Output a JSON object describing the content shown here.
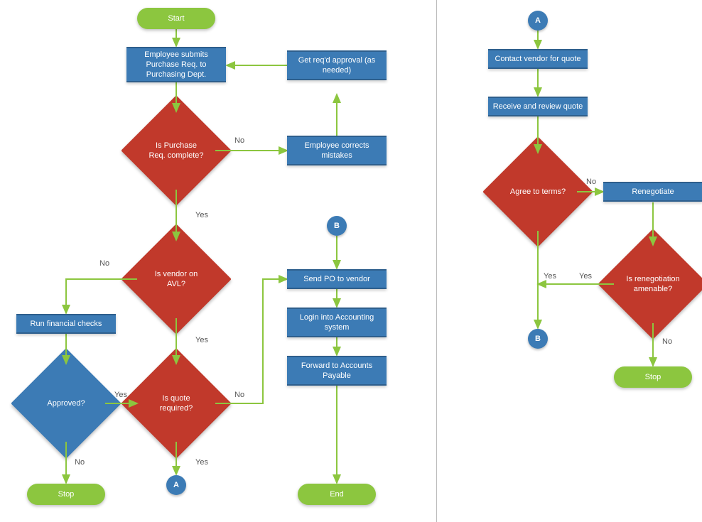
{
  "chart_data": {
    "type": "flowchart",
    "panes": [
      {
        "id": "left",
        "nodes": [
          {
            "id": "start",
            "type": "terminator",
            "label": "Start"
          },
          {
            "id": "submit",
            "type": "process",
            "label": "Employee submits Purchase Req. to Purchasing Dept."
          },
          {
            "id": "getapproval",
            "type": "process",
            "label": "Get req'd approval (as needed)"
          },
          {
            "id": "complete",
            "type": "decision",
            "label": "Is Purchase Req. complete?"
          },
          {
            "id": "corrects",
            "type": "process",
            "label": "Employee corrects mistakes"
          },
          {
            "id": "avl",
            "type": "decision",
            "label": "Is vendor on AVL?"
          },
          {
            "id": "financial",
            "type": "process",
            "label": "Run financial checks"
          },
          {
            "id": "approved",
            "type": "decision",
            "label": "Approved?"
          },
          {
            "id": "quote",
            "type": "decision",
            "label": "Is quote required?"
          },
          {
            "id": "stop1",
            "type": "terminator",
            "label": "Stop"
          },
          {
            "id": "a_out",
            "type": "connector",
            "label": "A"
          },
          {
            "id": "b_in",
            "type": "connector",
            "label": "B"
          },
          {
            "id": "sendpo",
            "type": "process",
            "label": "Send PO to vendor"
          },
          {
            "id": "login",
            "type": "process",
            "label": "Login into Accounting system"
          },
          {
            "id": "forward",
            "type": "process",
            "label": "Forward to Accounts Payable"
          },
          {
            "id": "end",
            "type": "terminator",
            "label": "End"
          }
        ],
        "edges": [
          {
            "from": "start",
            "to": "submit"
          },
          {
            "from": "submit",
            "to": "complete"
          },
          {
            "from": "complete",
            "to": "avl",
            "label": "Yes"
          },
          {
            "from": "complete",
            "to": "corrects",
            "label": "No"
          },
          {
            "from": "corrects",
            "to": "getapproval"
          },
          {
            "from": "getapproval",
            "to": "submit"
          },
          {
            "from": "avl",
            "to": "financial",
            "label": "No"
          },
          {
            "from": "avl",
            "to": "quote",
            "label": "Yes"
          },
          {
            "from": "financial",
            "to": "approved"
          },
          {
            "from": "approved",
            "to": "quote",
            "label": "Yes"
          },
          {
            "from": "approved",
            "to": "stop1",
            "label": "No"
          },
          {
            "from": "quote",
            "to": "a_out",
            "label": "Yes"
          },
          {
            "from": "quote",
            "to": "sendpo",
            "label": "No"
          },
          {
            "from": "b_in",
            "to": "sendpo"
          },
          {
            "from": "sendpo",
            "to": "login"
          },
          {
            "from": "login",
            "to": "forward"
          },
          {
            "from": "forward",
            "to": "end"
          }
        ]
      },
      {
        "id": "right",
        "nodes": [
          {
            "id": "a_in",
            "type": "connector",
            "label": "A"
          },
          {
            "id": "contact",
            "type": "process",
            "label": "Contact vendor for quote"
          },
          {
            "id": "receive",
            "type": "process",
            "label": "Receive and review quote"
          },
          {
            "id": "agree",
            "type": "decision",
            "label": "Agree to terms?"
          },
          {
            "id": "reneg",
            "type": "process",
            "label": "Renegotiate"
          },
          {
            "id": "amenable",
            "type": "decision",
            "label": "Is renegotiation amenable?"
          },
          {
            "id": "b_out",
            "type": "connector",
            "label": "B"
          },
          {
            "id": "stop2",
            "type": "terminator",
            "label": "Stop"
          }
        ],
        "edges": [
          {
            "from": "a_in",
            "to": "contact"
          },
          {
            "from": "contact",
            "to": "receive"
          },
          {
            "from": "receive",
            "to": "agree"
          },
          {
            "from": "agree",
            "to": "b_out",
            "label": "Yes"
          },
          {
            "from": "agree",
            "to": "reneg",
            "label": "No"
          },
          {
            "from": "reneg",
            "to": "amenable"
          },
          {
            "from": "amenable",
            "to": "agree",
            "label": "Yes"
          },
          {
            "from": "amenable",
            "to": "stop2",
            "label": "No"
          }
        ]
      }
    ]
  },
  "labels": {
    "yes": "Yes",
    "no": "No"
  },
  "n": {
    "start": "Start",
    "submit": "Employee submits Purchase Req. to Purchasing Dept.",
    "getapproval": "Get req'd approval (as needed)",
    "complete": "Is Purchase Req. complete?",
    "corrects": "Employee corrects mistakes",
    "avl": "Is vendor on AVL?",
    "financial": "Run financial checks",
    "approved": "Approved?",
    "quote": "Is quote required?",
    "stop1": "Stop",
    "a_out": "A",
    "b_in": "B",
    "sendpo": "Send PO to vendor",
    "login": "Login into Accounting system",
    "forward": "Forward to Accounts Payable",
    "end": "End",
    "a_in": "A",
    "contact": "Contact vendor for quote",
    "receive": "Receive and review quote",
    "agree": "Agree to terms?",
    "reneg": "Renegotiate",
    "amenable": "Is renegotiation amenable?",
    "b_out": "B",
    "stop2": "Stop"
  }
}
